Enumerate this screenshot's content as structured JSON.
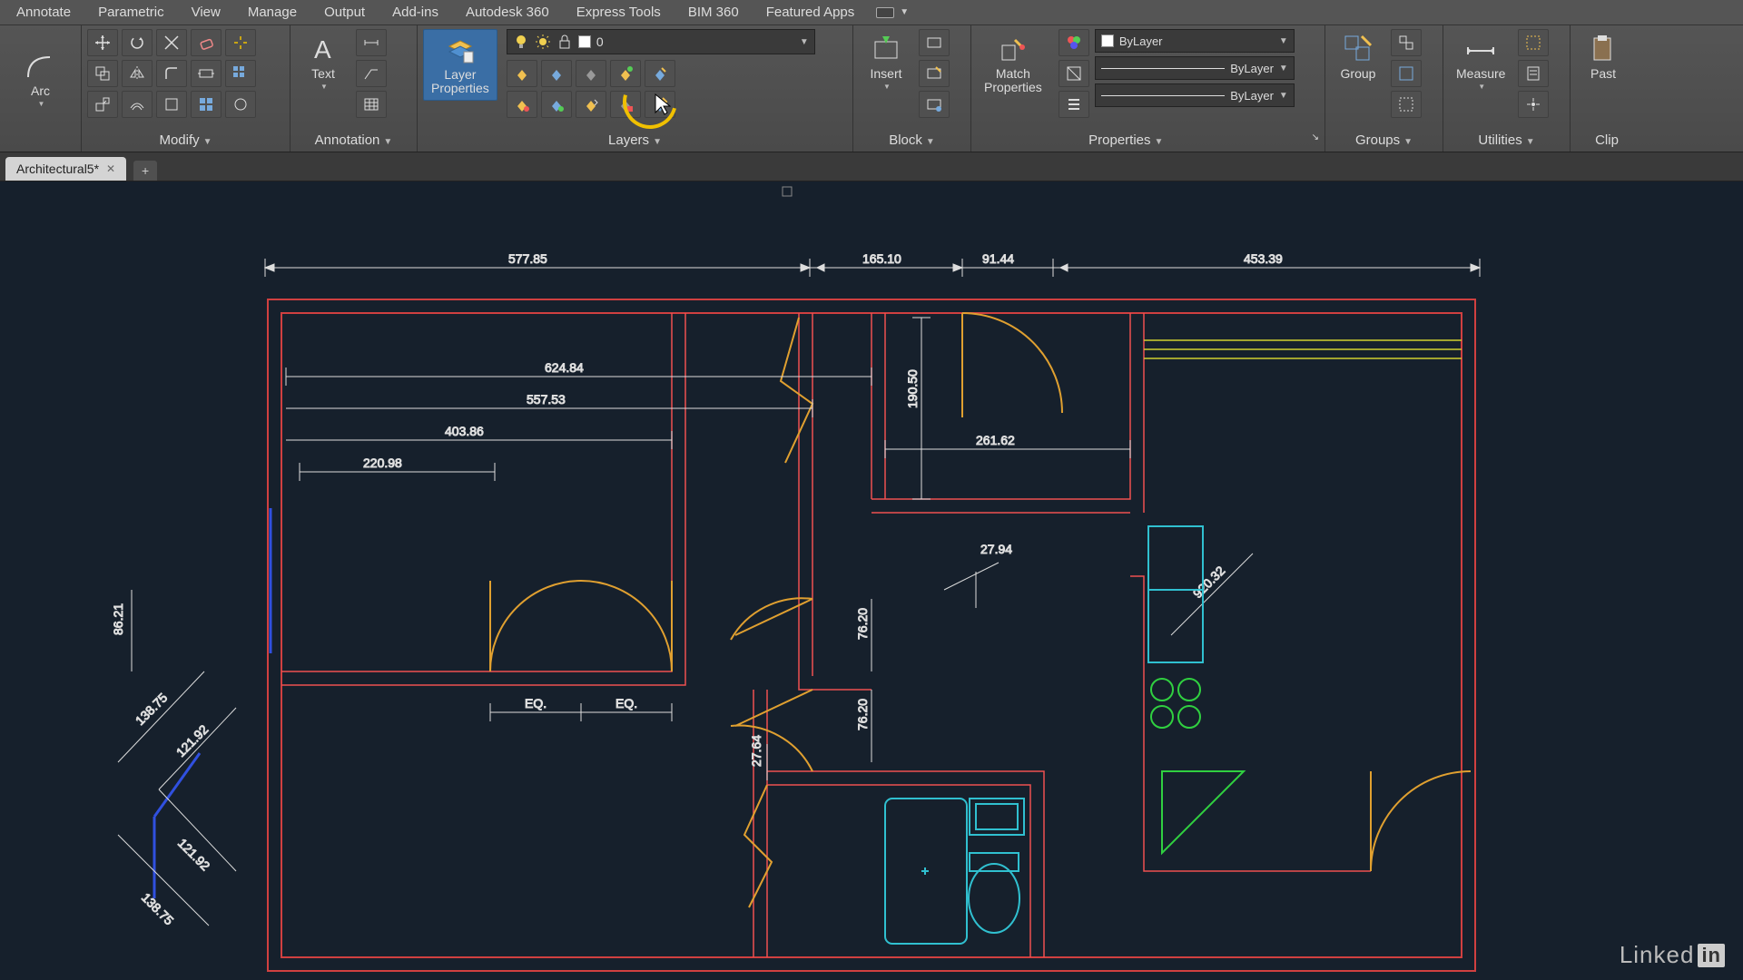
{
  "menus": [
    "Annotate",
    "Parametric",
    "View",
    "Manage",
    "Output",
    "Add-ins",
    "Autodesk 360",
    "Express Tools",
    "BIM 360",
    "Featured Apps"
  ],
  "ribbon": {
    "draw": {
      "arc": "Arc"
    },
    "modify": {
      "title": "Modify"
    },
    "annotation": {
      "title": "Annotation",
      "text": "Text"
    },
    "layers": {
      "title": "Layers",
      "layer_properties": "Layer\nProperties",
      "current_layer": "0"
    },
    "block": {
      "title": "Block",
      "insert": "Insert"
    },
    "properties": {
      "title": "Properties",
      "match": "Match\nProperties",
      "color": "ByLayer",
      "lineweight": "ByLayer",
      "linetype": "ByLayer"
    },
    "groups": {
      "title": "Groups",
      "group": "Group"
    },
    "utilities": {
      "title": "Utilities",
      "measure": "Measure"
    },
    "clipboard": {
      "title": "Clip",
      "paste": "Past"
    }
  },
  "tabs": {
    "active": "Architectural5*"
  },
  "dimensions": {
    "top1": "577.85",
    "top2": "165.10",
    "top3": "91.44",
    "top4": "453.39",
    "h1": "624.84",
    "h2": "557.53",
    "h3": "403.86",
    "h4": "220.98",
    "h5": "261.62",
    "eq": "EQ.",
    "v1": "190.50",
    "v2": "76.20",
    "v3": "27.94",
    "v4": "76.20",
    "v5": "27.64",
    "l1": "86.21",
    "l2": "138.75",
    "l3": "121.92",
    "l4": "121.92",
    "l5": "138.75",
    "diag": "920.32"
  },
  "watermark": {
    "text": "Linked",
    "suffix": "in"
  }
}
